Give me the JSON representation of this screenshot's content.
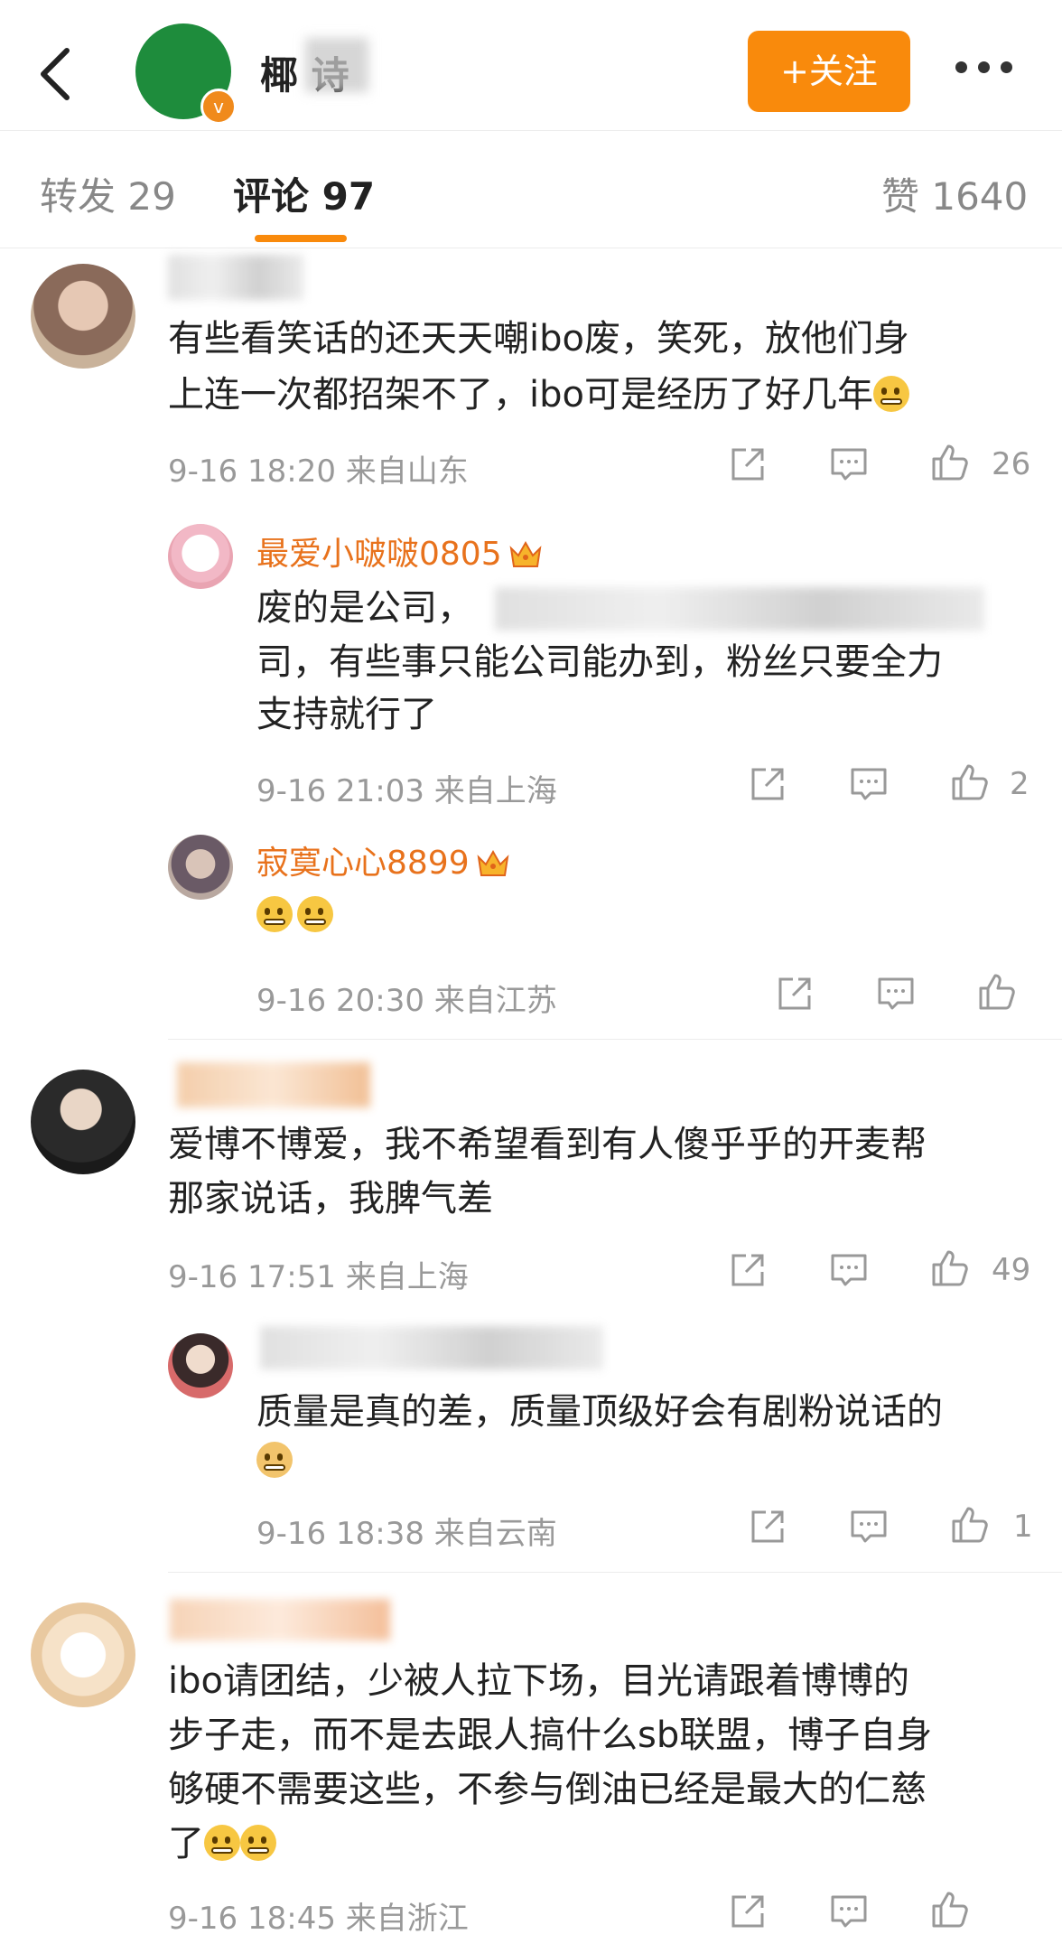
{
  "header": {
    "username": "椰   诗",
    "follow_label": "+关注"
  },
  "tabs": {
    "repost": "转发 29",
    "comments": "评论 97",
    "likes": "赞 1640"
  },
  "comments": [
    {
      "text_line1": "有些看笑话的还天天嘲ibo废，笑死，放他们身",
      "text_line2": "上连一次都招架不了，ibo可是经历了好几年",
      "meta": "9-16 18:20  来自山东",
      "likes": "26",
      "replies": [
        {
          "name": "最爱小啵啵0805",
          "text_line1": "废的是公司，",
          "text_line2": "司，有些事只能公司能办到，粉丝只要全力",
          "text_line3": "支持就行了",
          "meta": "9-16 21:03  来自上海",
          "likes": "2"
        },
        {
          "name": "寂寞心心8899",
          "meta": "9-16 20:30  来自江苏",
          "likes": ""
        }
      ]
    },
    {
      "text_line1": "爱博不博爱，我不希望看到有人傻乎乎的开麦帮",
      "text_line2": "那家说话，我脾气差",
      "meta": "9-16 17:51  来自上海",
      "likes": "49",
      "replies": [
        {
          "text_line1": "质量是真的差，质量顶级好会有剧粉说话的",
          "meta": "9-16 18:38  来自云南",
          "likes": "1"
        }
      ]
    },
    {
      "text_line1": "ibo请团结，少被人拉下场，目光请跟着博博的",
      "text_line2": "步子走，而不是去跟人搞什么sb联盟，博子自身",
      "text_line3": "够硬不需要这些，不参与倒油已经是最大的仁慈",
      "text_line4": "了",
      "meta": "9-16 18:45  来自浙江"
    }
  ]
}
